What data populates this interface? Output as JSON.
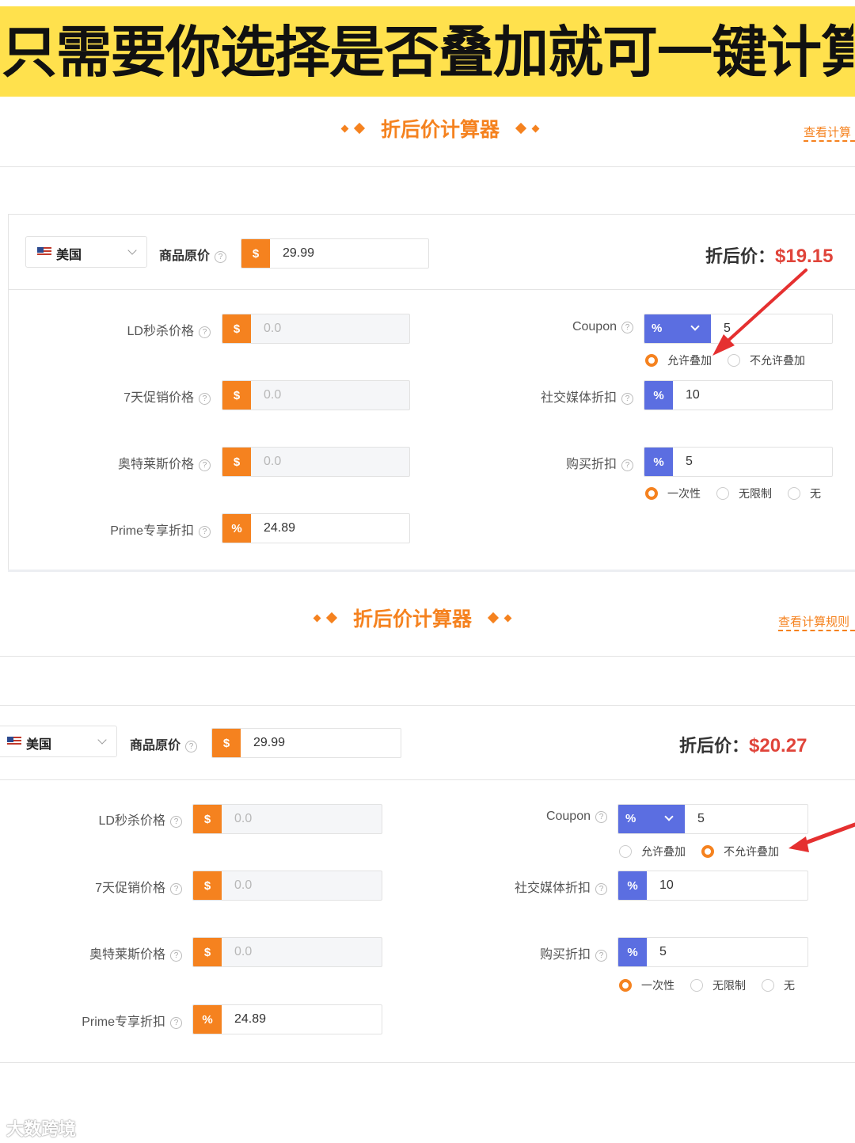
{
  "banner": {
    "text": "只需要你选择是否叠加就可一键计算"
  },
  "panels": [
    {
      "title": "折后价计算器",
      "rules_link": "查看计算",
      "country": "美国",
      "original_price_label": "商品原价",
      "original_price": "29.99",
      "result_label": "折后价：",
      "result_value": "$19.15",
      "ld_label": "LD秒杀价格",
      "ld_value": "0.0",
      "seven_day_label": "7天促销价格",
      "seven_day_value": "0.0",
      "outlet_label": "奥特莱斯价格",
      "outlet_value": "0.0",
      "prime_label": "Prime专享折扣",
      "prime_value": "24.89",
      "coupon_label": "Coupon",
      "coupon_unit": "%",
      "coupon_value": "5",
      "stack_allow": "允许叠加",
      "stack_disallow": "不允许叠加",
      "stack_selected": "allow",
      "social_label": "社交媒体折扣",
      "social_value": "10",
      "purchase_label": "购买折扣",
      "purchase_value": "5",
      "opt_once": "一次性",
      "opt_unlimited": "无限制",
      "opt_none": "无",
      "purchase_selected": "once"
    },
    {
      "title": "折后价计算器",
      "rules_link": "查看计算规则",
      "country": "美国",
      "original_price_label": "商品原价",
      "original_price": "29.99",
      "result_label": "折后价：",
      "result_value": "$20.27",
      "ld_label": "LD秒杀价格",
      "ld_value": "0.0",
      "seven_day_label": "7天促销价格",
      "seven_day_value": "0.0",
      "outlet_label": "奥特莱斯价格",
      "outlet_value": "0.0",
      "prime_label": "Prime专享折扣",
      "prime_value": "24.89",
      "coupon_label": "Coupon",
      "coupon_unit": "%",
      "coupon_value": "5",
      "stack_allow": "允许叠加",
      "stack_disallow": "不允许叠加",
      "stack_selected": "disallow",
      "social_label": "社交媒体折扣",
      "social_value": "10",
      "purchase_label": "购买折扣",
      "purchase_value": "5",
      "opt_once": "一次性",
      "opt_unlimited": "无限制",
      "opt_none": "无",
      "purchase_selected": "once"
    }
  ],
  "common": {
    "dollar": "$",
    "percent": "%",
    "help": "?"
  },
  "watermark": "大数跨境",
  "colors": {
    "accent": "#f5821f",
    "select_blue": "#5b6ee1",
    "price_red": "#e0443a",
    "banner_yellow": "#ffe14d",
    "arrow_red": "#e53030"
  }
}
